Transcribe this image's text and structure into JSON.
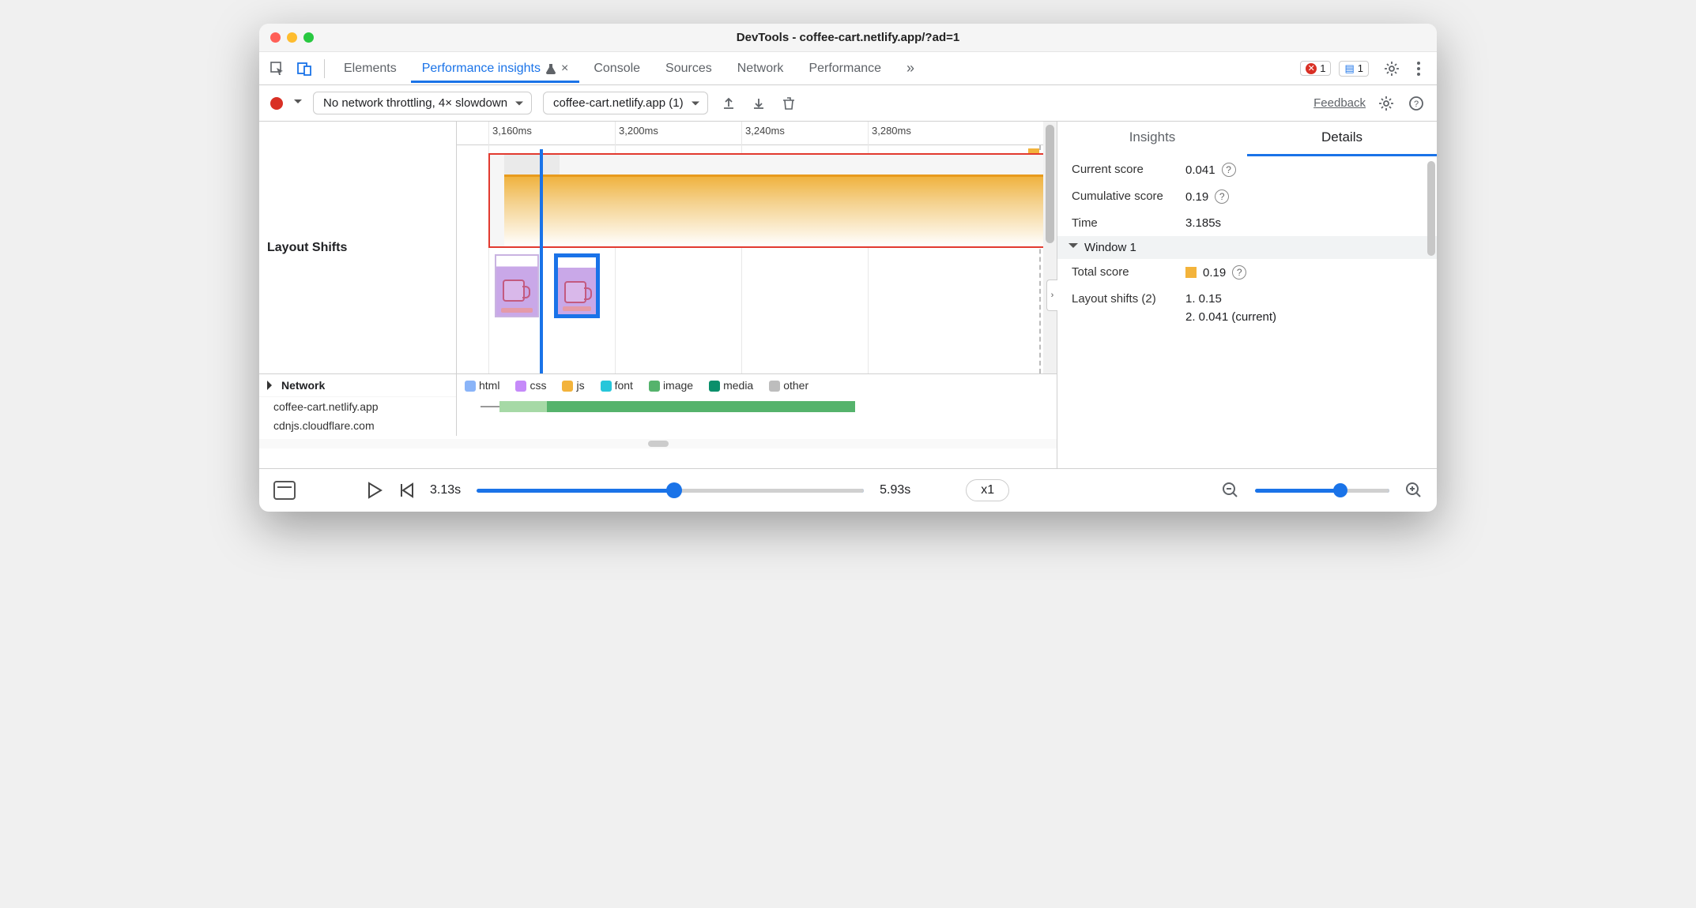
{
  "window": {
    "title": "DevTools - coffee-cart.netlify.app/?ad=1"
  },
  "tabs": {
    "items": [
      "Elements",
      "Performance insights",
      "Console",
      "Sources",
      "Network",
      "Performance"
    ],
    "active": 1,
    "overflow": "»",
    "errors_count": "1",
    "messages_count": "1"
  },
  "toolbar": {
    "throttling": "No network throttling, 4× slowdown",
    "recording": "coffee-cart.netlify.app (1)",
    "feedback": "Feedback"
  },
  "timeline": {
    "ticks": [
      "3,160ms",
      "3,200ms",
      "3,240ms",
      "3,280ms"
    ],
    "row_label": "Layout Shifts"
  },
  "network": {
    "header": "Network",
    "hosts": [
      "coffee-cart.netlify.app",
      "cdnjs.cloudflare.com"
    ],
    "legend": [
      {
        "label": "html",
        "color": "#8ab4f8"
      },
      {
        "label": "css",
        "color": "#c58af9"
      },
      {
        "label": "js",
        "color": "#f3b33b"
      },
      {
        "label": "font",
        "color": "#26c6da"
      },
      {
        "label": "image",
        "color": "#55b36c"
      },
      {
        "label": "media",
        "color": "#0a8f6b"
      },
      {
        "label": "other",
        "color": "#bdbdbd"
      }
    ]
  },
  "details": {
    "tabs": [
      "Insights",
      "Details"
    ],
    "active": 1,
    "current_score_label": "Current score",
    "current_score": "0.041",
    "cumulative_label": "Cumulative score",
    "cumulative": "0.19",
    "time_label": "Time",
    "time": "3.185s",
    "window_label": "Window 1",
    "total_label": "Total score",
    "total": "0.19",
    "shifts_label": "Layout shifts (2)",
    "shifts": [
      "1. 0.15",
      "2. 0.041 (current)"
    ]
  },
  "footer": {
    "start": "3.13s",
    "end": "5.93s",
    "speed": "x1"
  }
}
